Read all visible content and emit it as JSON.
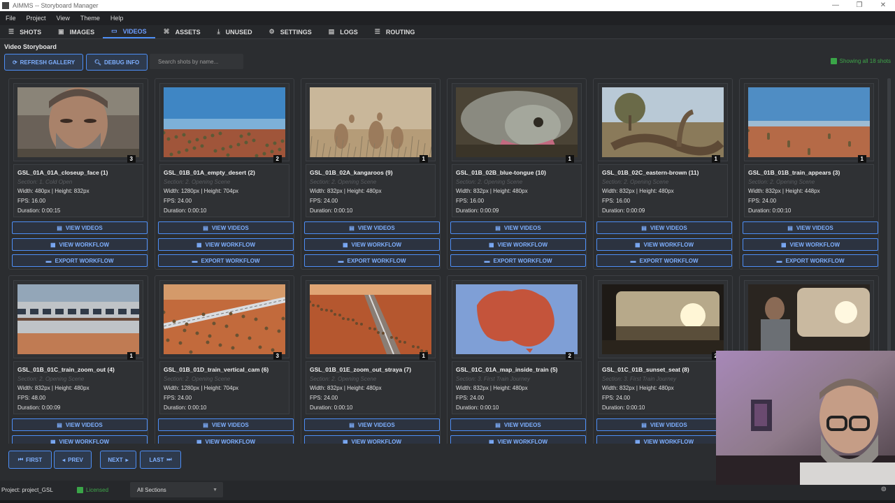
{
  "window": {
    "title": "AIMMS -- Storyboard Manager"
  },
  "menu": [
    "File",
    "Project",
    "View",
    "Theme",
    "Help"
  ],
  "tabs": [
    {
      "label": "SHOTS",
      "icon": "list-icon",
      "active": false
    },
    {
      "label": "IMAGES",
      "icon": "image-icon",
      "active": false
    },
    {
      "label": "VIDEOS",
      "icon": "video-icon",
      "active": true
    },
    {
      "label": "ASSETS",
      "icon": "assets-icon",
      "active": false
    },
    {
      "label": "UNUSED",
      "icon": "download-icon",
      "active": false
    },
    {
      "label": "SETTINGS",
      "icon": "gear-icon",
      "active": false
    },
    {
      "label": "LOGS",
      "icon": "document-icon",
      "active": false
    },
    {
      "label": "ROUTING",
      "icon": "routing-icon",
      "active": false
    }
  ],
  "toolbar": {
    "section_title": "Video Storyboard",
    "refresh_label": "REFRESH GALLERY",
    "debug_label": "DEBUG INFO",
    "search_placeholder": "Search shots by name...",
    "showing_label": "Showing all 18 shots"
  },
  "card_buttons": {
    "view_videos": "VIEW VIDEOS",
    "view_workflow": "VIEW WORKFLOW",
    "export_workflow": "EXPORT WORKFLOW"
  },
  "cards": [
    {
      "title": "GSL_01A_01A_closeup_face (1)",
      "section": "Section: 1. Cold Open",
      "dims": "Width: 480px | Height: 832px",
      "fps": "FPS: 16.00",
      "duration": "Duration: 0:00:15",
      "count": "3",
      "thumb": "face"
    },
    {
      "title": "GSL_01B_01A_empty_desert (2)",
      "section": "Section: 2. Opening Scene",
      "dims": "Width: 1280px | Height: 704px",
      "fps": "FPS: 24.00",
      "duration": "Duration: 0:00:10",
      "count": "2",
      "thumb": "desert"
    },
    {
      "title": "GSL_01B_02A_kangaroos (9)",
      "section": "Section: 2. Opening Scene",
      "dims": "Width: 832px | Height: 480px",
      "fps": "FPS: 24.00",
      "duration": "Duration: 0:00:10",
      "count": "1",
      "thumb": "kangaroos"
    },
    {
      "title": "GSL_01B_02B_blue-tongue (10)",
      "section": "Section: 2. Opening Scene",
      "dims": "Width: 832px | Height: 480px",
      "fps": "FPS: 16.00",
      "duration": "Duration: 0:00:09",
      "count": "1",
      "thumb": "lizard"
    },
    {
      "title": "GSL_01B_02C_eastern-brown (11)",
      "section": "Section: 2. Opening Scene",
      "dims": "Width: 832px | Height: 480px",
      "fps": "FPS: 16.00",
      "duration": "Duration: 0:00:09",
      "count": "1",
      "thumb": "snake"
    },
    {
      "title": "GSL_01B_01B_train_appears (3)",
      "section": "Section: 2. Opening Scene",
      "dims": "Width: 832px | Height: 448px",
      "fps": "FPS: 24.00",
      "duration": "Duration: 0:00:10",
      "count": "1",
      "thumb": "outback"
    },
    {
      "title": "GSL_01B_01C_train_zoom_out (4)",
      "section": "Section: 2. Opening Scene",
      "dims": "Width: 832px | Height: 480px",
      "fps": "FPS: 48.00",
      "duration": "Duration: 0:00:09",
      "count": "1",
      "thumb": "train"
    },
    {
      "title": "GSL_01B_01D_train_vertical_cam (6)",
      "section": "Section: 2. Opening Scene",
      "dims": "Width: 1280px | Height: 704px",
      "fps": "FPS: 24.00",
      "duration": "Duration: 0:00:10",
      "count": "3",
      "thumb": "trainaerial"
    },
    {
      "title": "GSL_01B_01E_zoom_out_straya (7)",
      "section": "Section: 2. Opening Scene",
      "dims": "Width: 832px | Height: 480px",
      "fps": "FPS: 24.00",
      "duration": "Duration: 0:00:10",
      "count": "1",
      "thumb": "track"
    },
    {
      "title": "GSL_01C_01A_map_inside_train (5)",
      "section": "Section: 3. First Train Journey",
      "dims": "Width: 832px | Height: 480px",
      "fps": "FPS: 24.00",
      "duration": "Duration: 0:00:10",
      "count": "2",
      "thumb": "map"
    },
    {
      "title": "GSL_01C_01B_sunset_seat (8)",
      "section": "Section: 3. First Train Journey",
      "dims": "Width: 832px | Height: 480px",
      "fps": "FPS: 24.00",
      "duration": "Duration: 0:00:10",
      "count": "2",
      "thumb": "sunset"
    },
    {
      "title": "",
      "section": "",
      "dims": "",
      "fps": "",
      "duration": "",
      "count": "",
      "thumb": "man-window"
    }
  ],
  "pagination": {
    "first": "FIRST",
    "prev": "PREV",
    "next": "NEXT",
    "last": "LAST"
  },
  "status": {
    "project": "Project: project_GSL",
    "license": "Licensed",
    "section_select": "All Sections"
  },
  "colors": {
    "accent": "#4d8ef5",
    "background": "#2b2d30",
    "success": "#3fa64a"
  }
}
